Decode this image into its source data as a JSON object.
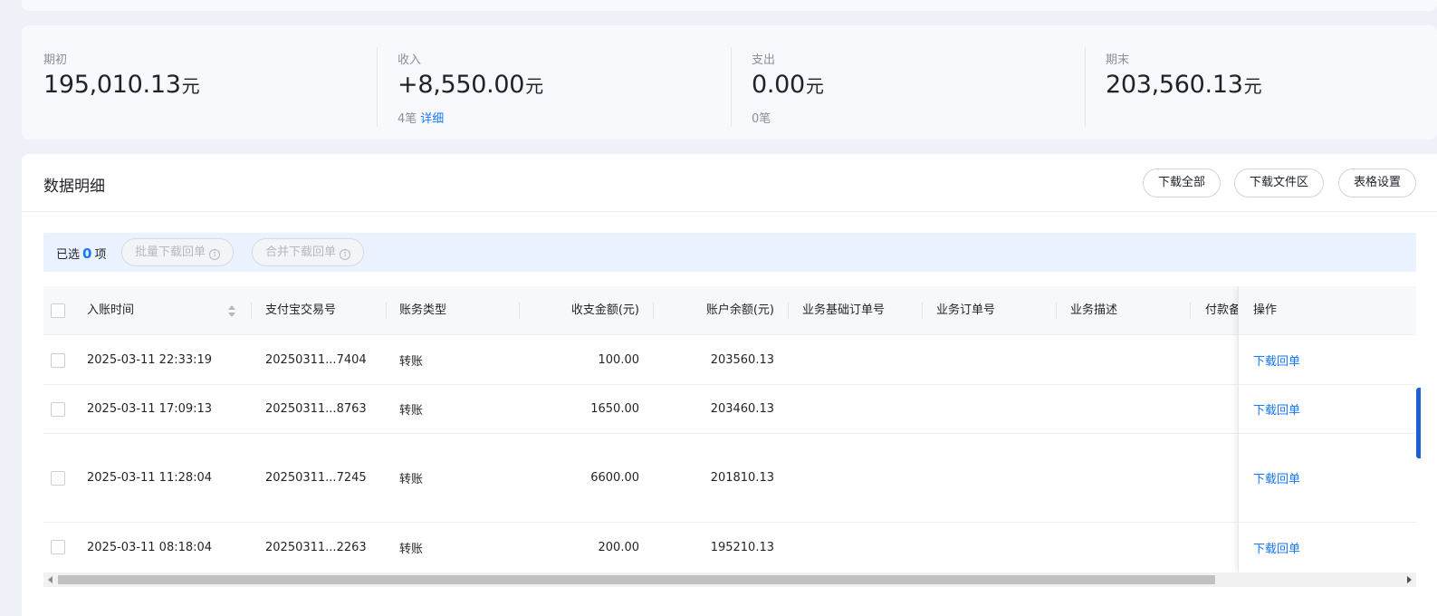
{
  "summary": {
    "items": [
      {
        "label": "期初",
        "value": "195,010.13",
        "unit": "元",
        "sub_count": "",
        "sub_link": ""
      },
      {
        "label": "收入",
        "value": "+8,550.00",
        "unit": "元",
        "sub_count": "4笔",
        "sub_link": "详细"
      },
      {
        "label": "支出",
        "value": "0.00",
        "unit": "元",
        "sub_count": "0笔",
        "sub_link": ""
      },
      {
        "label": "期末",
        "value": "203,560.13",
        "unit": "元",
        "sub_count": "",
        "sub_link": ""
      }
    ]
  },
  "detail": {
    "title": "数据明细",
    "buttons": {
      "download_all": "下载全部",
      "download_files": "下载文件区",
      "table_settings": "表格设置"
    }
  },
  "selection": {
    "prefix": "已选",
    "count": "0",
    "suffix": "项",
    "batch_download": "批量下载回单",
    "merge_download": "合并下载回单"
  },
  "table": {
    "columns": [
      "入账时间",
      "支付宝交易号",
      "账务类型",
      "收支金额(元)",
      "账户余额(元)",
      "业务基础订单号",
      "业务订单号",
      "业务描述",
      "付款备",
      "操作"
    ],
    "rows": [
      {
        "time": "2025-03-11 22:33:19",
        "trade_no": "20250311...7404",
        "type": "转账",
        "amount": "100.00",
        "balance": "203560.13",
        "base_order": "",
        "order": "",
        "desc": "",
        "payer": "",
        "action": "下载回单"
      },
      {
        "time": "2025-03-11 17:09:13",
        "trade_no": "20250311...8763",
        "type": "转账",
        "amount": "1650.00",
        "balance": "203460.13",
        "base_order": "",
        "order": "",
        "desc": "",
        "payer": "",
        "action": "下载回单"
      },
      {
        "time": "2025-03-11 11:28:04",
        "trade_no": "20250311...7245",
        "type": "转账",
        "amount": "6600.00",
        "balance": "201810.13",
        "base_order": "",
        "order": "",
        "desc": "",
        "payer": "",
        "action": "下载回单"
      },
      {
        "time": "2025-03-11 08:18:04",
        "trade_no": "20250311...2263",
        "type": "转账",
        "amount": "200.00",
        "balance": "195210.13",
        "base_order": "",
        "order": "",
        "desc": "",
        "payer": "",
        "action": "下载回单"
      }
    ]
  },
  "colors": {
    "accent": "#1677ff",
    "page_bg": "#eef1f8"
  }
}
